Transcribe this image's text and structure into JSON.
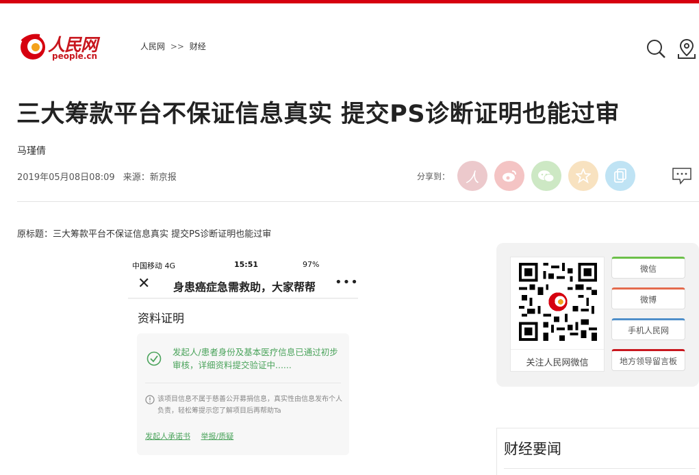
{
  "colors": {
    "brand": "#c8161d",
    "top_bar": "#d6000f",
    "verify_green": "#4aa35b"
  },
  "logo": {
    "cn": "人民网",
    "en": "people.cn"
  },
  "breadcrumb": {
    "home": "人民网",
    "separator": ">>",
    "section": "财经"
  },
  "header_icons": [
    "search-icon",
    "location-icon"
  ],
  "article": {
    "title": "三大筹款平台不保证信息真实 提交PS诊断证明也能过审",
    "author": "马瑾倩",
    "date": "2019年05月08日08:09",
    "source": "来源：新京报",
    "original_title": "原标题：三大筹款平台不保证信息真实 提交PS诊断证明也能过审"
  },
  "share": {
    "label": "分享到：",
    "buttons": [
      "people-share-icon",
      "weibo-share-icon",
      "wechat-share-icon",
      "qzone-share-icon",
      "copy-link-icon"
    ]
  },
  "phone": {
    "carrier": "中国移动 4G",
    "time": "15:51",
    "battery": "97%",
    "close": "✕",
    "nav_title": "身患癌症急需救助，大家帮帮",
    "more": "•••",
    "heading": "资料证明",
    "verify_text": "发起人/患者身份及基本医疗信息已通过初步审核，详细资料提交验证中......",
    "warning_text": "该项目信息不属于慈善公开募捐信息，真实性由信息发布个人负责，轻松筹提示您了解项目后再帮助Ta",
    "link_promise": "发起人承诺书",
    "link_report": "举报/质疑"
  },
  "sidebar": {
    "qr_caption": "关注人民网微信",
    "buttons": {
      "wechat": "微信",
      "weibo": "微博",
      "mobile": "手机人民网",
      "leader": "地方领导留言板"
    }
  },
  "news": {
    "title": "财经要闻"
  }
}
